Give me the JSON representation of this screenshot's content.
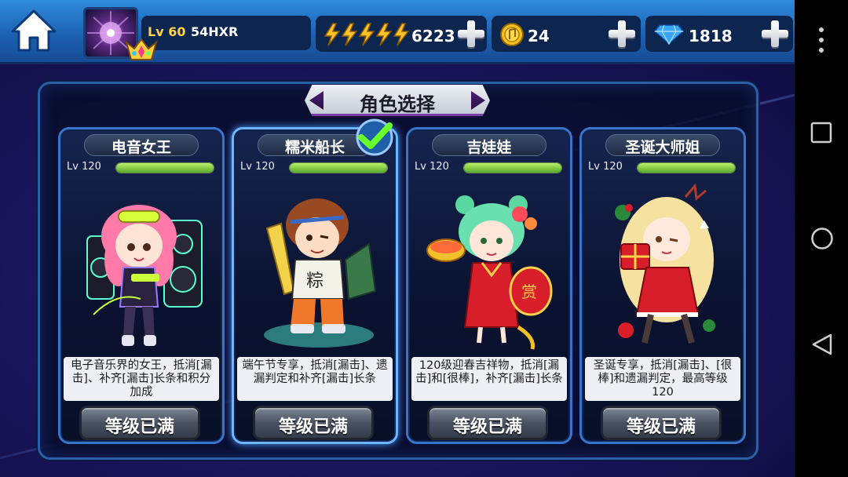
{
  "player": {
    "level": "Lv 60",
    "name": "54HXR"
  },
  "resources": {
    "energy": {
      "icon": "lightning-icon",
      "value": "6223"
    },
    "coins": {
      "icon": "gold-coin-icon",
      "value": "24"
    },
    "diamonds": {
      "icon": "diamond-icon",
      "value": "1818"
    }
  },
  "panel": {
    "title": "角色选择"
  },
  "characters": [
    {
      "name": "电音女王",
      "level": "Lv 120",
      "level_fill": 1.0,
      "desc": "电子音乐界的女王，抵消[漏击]、补齐[漏击]长条和积分加成",
      "button": "等级已满",
      "selected": false
    },
    {
      "name": "糯米船长",
      "level": "Lv 120",
      "level_fill": 1.0,
      "desc": "端午节专享，抵消[漏击]、遗漏判定和补齐[漏击]长条",
      "button": "等级已满",
      "selected": true
    },
    {
      "name": "吉娃娃",
      "level": "Lv 120",
      "level_fill": 1.0,
      "desc": "120级迎春吉祥物，抵消[漏击]和[很棒]，补齐[漏击]长条",
      "button": "等级已满",
      "selected": false
    },
    {
      "name": "圣诞大师姐",
      "level": "Lv 120",
      "level_fill": 1.0,
      "desc": "圣诞专享，抵消[漏击]、[很棒]和遗漏判定，最高等级120",
      "button": "等级已满",
      "selected": false
    }
  ],
  "colors": {
    "accent": "#2f8bdc",
    "level_bar": "#8cd94a",
    "gold": "#ffd24a"
  },
  "navigation": {
    "icons": [
      "more-vert-icon",
      "recents-square-icon",
      "home-circle-icon",
      "back-triangle-icon"
    ]
  }
}
